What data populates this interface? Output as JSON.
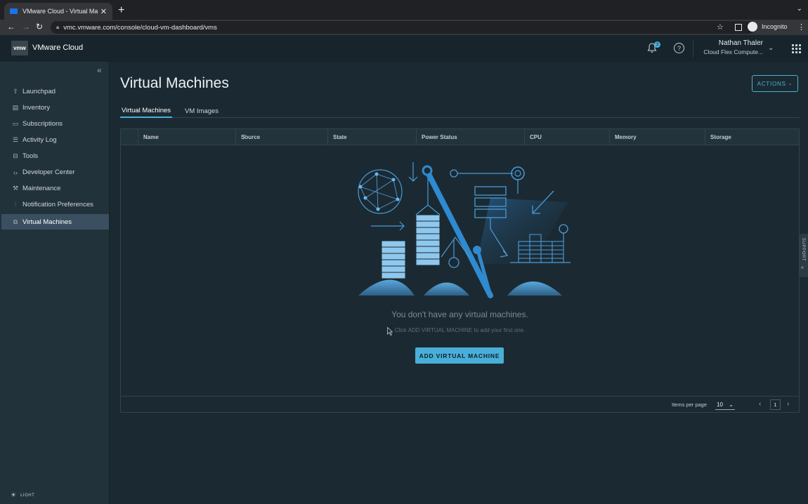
{
  "browser": {
    "tab_title": "VMware Cloud - Virtual Machi",
    "url": "vmc.vmware.com/console/cloud-vm-dashboard/vms",
    "profile_label": "Incognito"
  },
  "header": {
    "logo_text": "vmw",
    "app_name": "VMware Cloud",
    "notification_count": "3",
    "user_name": "Nathan Thaler",
    "user_org": "Cloud Flex Compute..."
  },
  "sidebar": {
    "items": [
      {
        "label": "Launchpad",
        "icon": "rocket-icon"
      },
      {
        "label": "Inventory",
        "icon": "inventory-icon"
      },
      {
        "label": "Subscriptions",
        "icon": "subscriptions-icon"
      },
      {
        "label": "Activity Log",
        "icon": "list-icon"
      },
      {
        "label": "Tools",
        "icon": "toolbox-icon"
      },
      {
        "label": "Developer Center",
        "icon": "code-icon"
      },
      {
        "label": "Maintenance",
        "icon": "wrench-icon"
      },
      {
        "label": "Notification Preferences",
        "icon": "sliders-icon"
      },
      {
        "label": "Virtual Machines",
        "icon": "vm-icon",
        "active": true
      }
    ],
    "theme_label": "LIGHT"
  },
  "main": {
    "title": "Virtual Machines",
    "actions_label": "ACTIONS",
    "tabs": [
      {
        "label": "Virtual Machines",
        "active": true
      },
      {
        "label": "VM Images",
        "active": false
      }
    ],
    "columns": [
      "Name",
      "Source",
      "State",
      "Power Status",
      "CPU",
      "Memory",
      "Storage"
    ],
    "empty_message": "You don't have any virtual machines.",
    "empty_hint": "Click ADD VIRTUAL MACHINE to add your first one.",
    "add_button_label": "ADD VIRTUAL MACHINE",
    "items_per_page_label": "Items per page",
    "items_per_page_value": "10",
    "current_page": "1"
  },
  "support_label": "SUPPORT",
  "colors": {
    "accent": "#49afd9",
    "background": "#1b2a32",
    "sidebar": "#22323a",
    "header": "#17242b"
  }
}
